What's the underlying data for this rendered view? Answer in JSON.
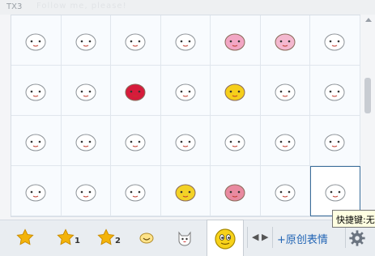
{
  "window": {
    "title": "TX3",
    "ghost_text": "Follow me, please!"
  },
  "grid": {
    "rows": 4,
    "columns": 7,
    "items": [
      {
        "name": "emoticon-blush-face"
      },
      {
        "name": "emoticon-call-sign"
      },
      {
        "name": "emoticon-sleepy-face"
      },
      {
        "name": "emoticon-green-sprout"
      },
      {
        "name": "emoticon-pink-pig"
      },
      {
        "name": "emoticon-small-pig"
      },
      {
        "name": "emoticon-pig-face"
      },
      {
        "name": "emoticon-sweat-face"
      },
      {
        "name": "emoticon-sad-face"
      },
      {
        "name": "emoticon-red-ball"
      },
      {
        "name": "emoticon-bird-on-head"
      },
      {
        "name": "emoticon-yellow-bubble"
      },
      {
        "name": "emoticon-squint-face"
      },
      {
        "name": "emoticon-desk-face"
      },
      {
        "name": "emoticon-nurse-face"
      },
      {
        "name": "emoticon-angry-face"
      },
      {
        "name": "emoticon-heart-face"
      },
      {
        "name": "emoticon-back-sign"
      },
      {
        "name": "emoticon-blank-face"
      },
      {
        "name": "emoticon-dizzy-face"
      },
      {
        "name": "emoticon-bunny-face"
      },
      {
        "name": "emoticon-flower-face"
      },
      {
        "name": "emoticon-x-eyes-face"
      },
      {
        "name": "emoticon-up-sign"
      },
      {
        "name": "emoticon-yellow-smile"
      },
      {
        "name": "emoticon-pink-blob"
      },
      {
        "name": "emoticon-twin-faces"
      },
      {
        "name": "emoticon-hair-face"
      }
    ],
    "selected_index": 27
  },
  "tooltip": {
    "text": "快捷键:无"
  },
  "toolbar": {
    "tabs": [
      {
        "name": "favorites-tab",
        "num": ""
      },
      {
        "name": "favorites-1-tab",
        "num": "1"
      },
      {
        "name": "favorites-2-tab",
        "num": "2"
      }
    ],
    "add_custom": "+原创表情",
    "prev_glyph": "◀",
    "next_glyph": "▶"
  },
  "colors": {
    "accent": "#2265b5",
    "star": "#f3b30a",
    "selection_border": "#3d6f9c"
  }
}
